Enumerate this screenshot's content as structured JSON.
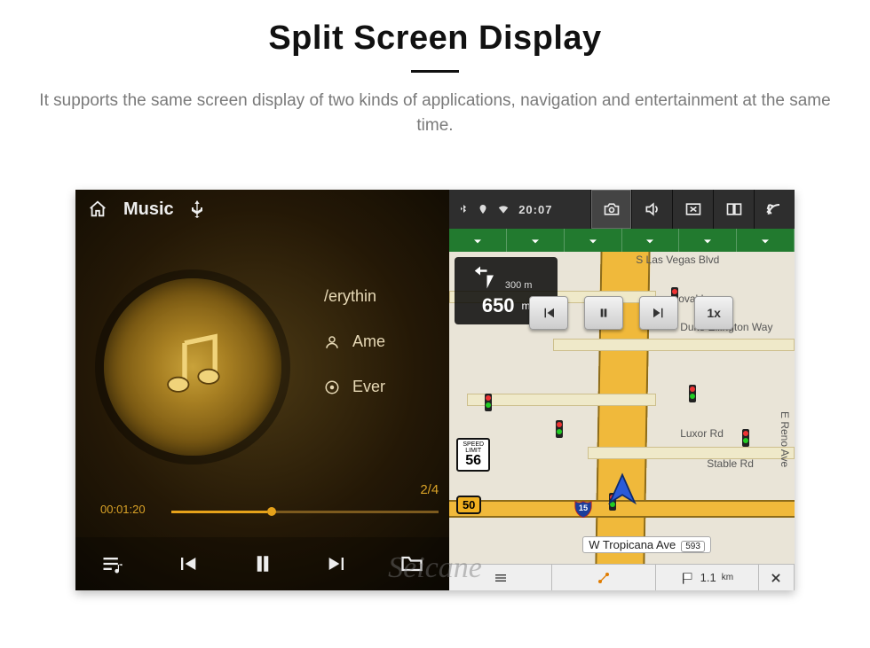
{
  "page": {
    "title": "Split Screen Display",
    "subtitle": "It supports the same screen display of two kinds of applications, navigation and entertainment at the same time."
  },
  "music": {
    "app_label": "Music",
    "source_icon_name": "usb-icon",
    "song_title": "/erythin",
    "artist": "Ame",
    "album": "Ever",
    "track_index": "2/4",
    "elapsed": "00:01:20",
    "progress_pct": 36
  },
  "statusbar": {
    "time": "20:07",
    "icons": [
      "bluetooth",
      "location",
      "wifi"
    ]
  },
  "toolbar": {
    "buttons": [
      "camera-icon",
      "volume-icon",
      "close-window-icon",
      "split-screen-icon",
      "back-icon"
    ]
  },
  "green_strip": {
    "icon": "download-arrow-icon",
    "count": 6
  },
  "nav": {
    "turn_hint_m": "300 m",
    "distance_m": "650",
    "distance_unit": "m",
    "speed_limit_label": "SPEED LIMIT",
    "speed_limit": "56",
    "route_shield": "50",
    "interstate": "15",
    "bottom_street": "W Tropicana Ave",
    "bottom_street_no": "593",
    "playback_speed": "1x",
    "streets": {
      "s_las_vegas": "S Las Vegas Blvd",
      "koval": "Koval Ln",
      "duke": "Duke Ellington Way",
      "luxor": "Luxor Rd",
      "stable": "Stable Rd",
      "reno": "E Reno Ave"
    },
    "footer_dist": "1.1",
    "footer_dist_unit": "km"
  },
  "watermark": "Seicane"
}
